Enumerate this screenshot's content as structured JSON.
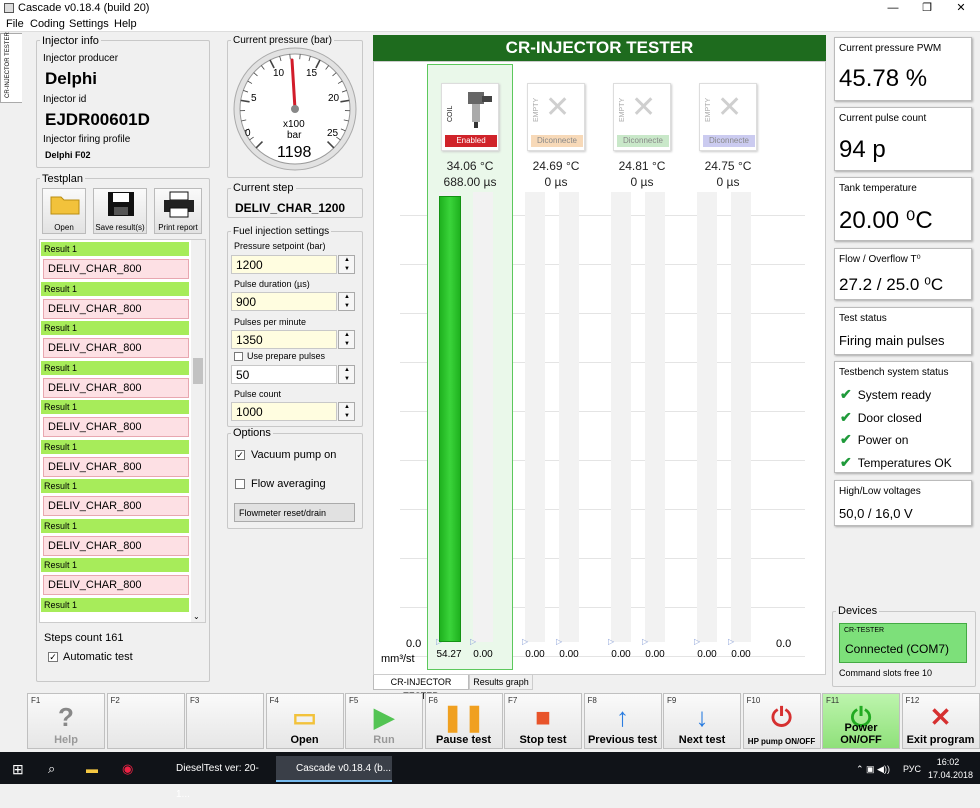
{
  "window": {
    "title": "Cascade v0.18.4 (build 20)",
    "min": "—",
    "max": "❐",
    "close": "✕"
  },
  "menu": [
    "File",
    "Coding",
    "Settings",
    "Help"
  ],
  "vtab": "CR-INJECTOR TESTER",
  "injector": {
    "group": "Injector info",
    "producer_label": "Injector producer",
    "producer": "Delphi",
    "id_label": "Injector id",
    "id": "EJDR00601D",
    "profile_label": "Injector firing profile",
    "profile": "Delphi F02"
  },
  "testplan": {
    "group": "Testplan",
    "open": "Open",
    "save": "Save result(s)",
    "print": "Print report",
    "result": "Result 1",
    "step": "DELIV_CHAR_800",
    "steps_count": "Steps count 161",
    "auto": "Automatic test"
  },
  "pressure": {
    "group": "Current pressure (bar)",
    "unit1": "x100",
    "unit2": "bar",
    "value": "1198",
    "ticks": [
      "0",
      "5",
      "10",
      "15",
      "20",
      "25"
    ]
  },
  "current_step": {
    "group": "Current step",
    "value": "DELIV_CHAR_1200"
  },
  "fuel": {
    "group": "Fuel injection settings",
    "setpoint_label": "Pressure setpoint (bar)",
    "setpoint": "1200",
    "duration_label": "Pulse duration (µs)",
    "duration": "900",
    "ppm_label": "Pulses per minute",
    "ppm": "1350",
    "prepare_label": "Use prepare pulses",
    "prepare": "50",
    "count_label": "Pulse count",
    "count": "1000"
  },
  "options": {
    "group": "Options",
    "vacuum": "Vacuum pump on",
    "flow": "Flow averaging",
    "reset": "Flowmeter reset/drain"
  },
  "tester": {
    "title": "CR-INJECTOR TESTER",
    "injectors": [
      {
        "type": "COIL",
        "status": "Enabled",
        "temp": "34.06 °C",
        "pulse": "688.00 µs",
        "v1": "54.27",
        "v2": "0.00",
        "color": "#d0232a"
      },
      {
        "type": "EMPTY",
        "status": "Diconnecte",
        "temp": "24.69 °C",
        "pulse": "0 µs",
        "v1": "0.00",
        "v2": "0.00",
        "color": "#f7d9b8"
      },
      {
        "type": "EMPTY",
        "status": "Diconnecte",
        "temp": "24.81 °C",
        "pulse": "0 µs",
        "v1": "0.00",
        "v2": "0.00",
        "color": "#c9e8c9"
      },
      {
        "type": "EMPTY",
        "status": "Diconnecte",
        "temp": "24.75 °C",
        "pulse": "0 µs",
        "v1": "0.00",
        "v2": "0.00",
        "color": "#cbcbf0"
      }
    ],
    "left_zero": "0.0",
    "right_zero": "0.0",
    "unit": "mm³/st",
    "fill_fraction": 0.99
  },
  "tabs": [
    "CR-INJECTOR TESTER",
    "Results graph"
  ],
  "right": {
    "pwm_label": "Current pressure PWM",
    "pwm": "45.78 %",
    "pulse_label": "Current pulse count",
    "pulse": "94 p",
    "tank_label": "Tank temperature",
    "tank": "20.00 ⁰C",
    "flow_label": "Flow / Overflow T⁰",
    "flow": "27.2 / 25.0 ⁰C",
    "status_label": "Test status",
    "status": "Firing main pulses",
    "system_label": "Testbench system status",
    "system": [
      "System ready",
      "Door closed",
      "Power on",
      "Temperatures OK"
    ],
    "hl_label": "High/Low voltages",
    "hl": "50,0 / 16,0 V"
  },
  "devices": {
    "group": "Devices",
    "name": "CR-TESTER",
    "conn": "Connected (COM7)",
    "slots": "Command slots free 10"
  },
  "fkeys": [
    {
      "key": "F1",
      "label": "Help",
      "icon": "?"
    },
    {
      "key": "F2",
      "label": "",
      "icon": ""
    },
    {
      "key": "F3",
      "label": "",
      "icon": ""
    },
    {
      "key": "F4",
      "label": "Open",
      "icon": "▭"
    },
    {
      "key": "F5",
      "label": "Run",
      "icon": "▶"
    },
    {
      "key": "F6",
      "label": "Pause test",
      "icon": "❚❚"
    },
    {
      "key": "F7",
      "label": "Stop test",
      "icon": "■"
    },
    {
      "key": "F8",
      "label": "Previous test",
      "icon": "↑"
    },
    {
      "key": "F9",
      "label": "Next test",
      "icon": "↓"
    },
    {
      "key": "F10",
      "label": "HP pump ON/OFF",
      "icon": "⏻"
    },
    {
      "key": "F11",
      "label": "Power ON/OFF",
      "icon": "⏻"
    },
    {
      "key": "F12",
      "label": "Exit program",
      "icon": "✕"
    }
  ],
  "taskbar": {
    "app1": "DieselTest ver: 20-1...",
    "app2": "Cascade v0.18.4 (b...",
    "lang": "РУС",
    "time": "16:02",
    "date": "17.04.2018"
  }
}
